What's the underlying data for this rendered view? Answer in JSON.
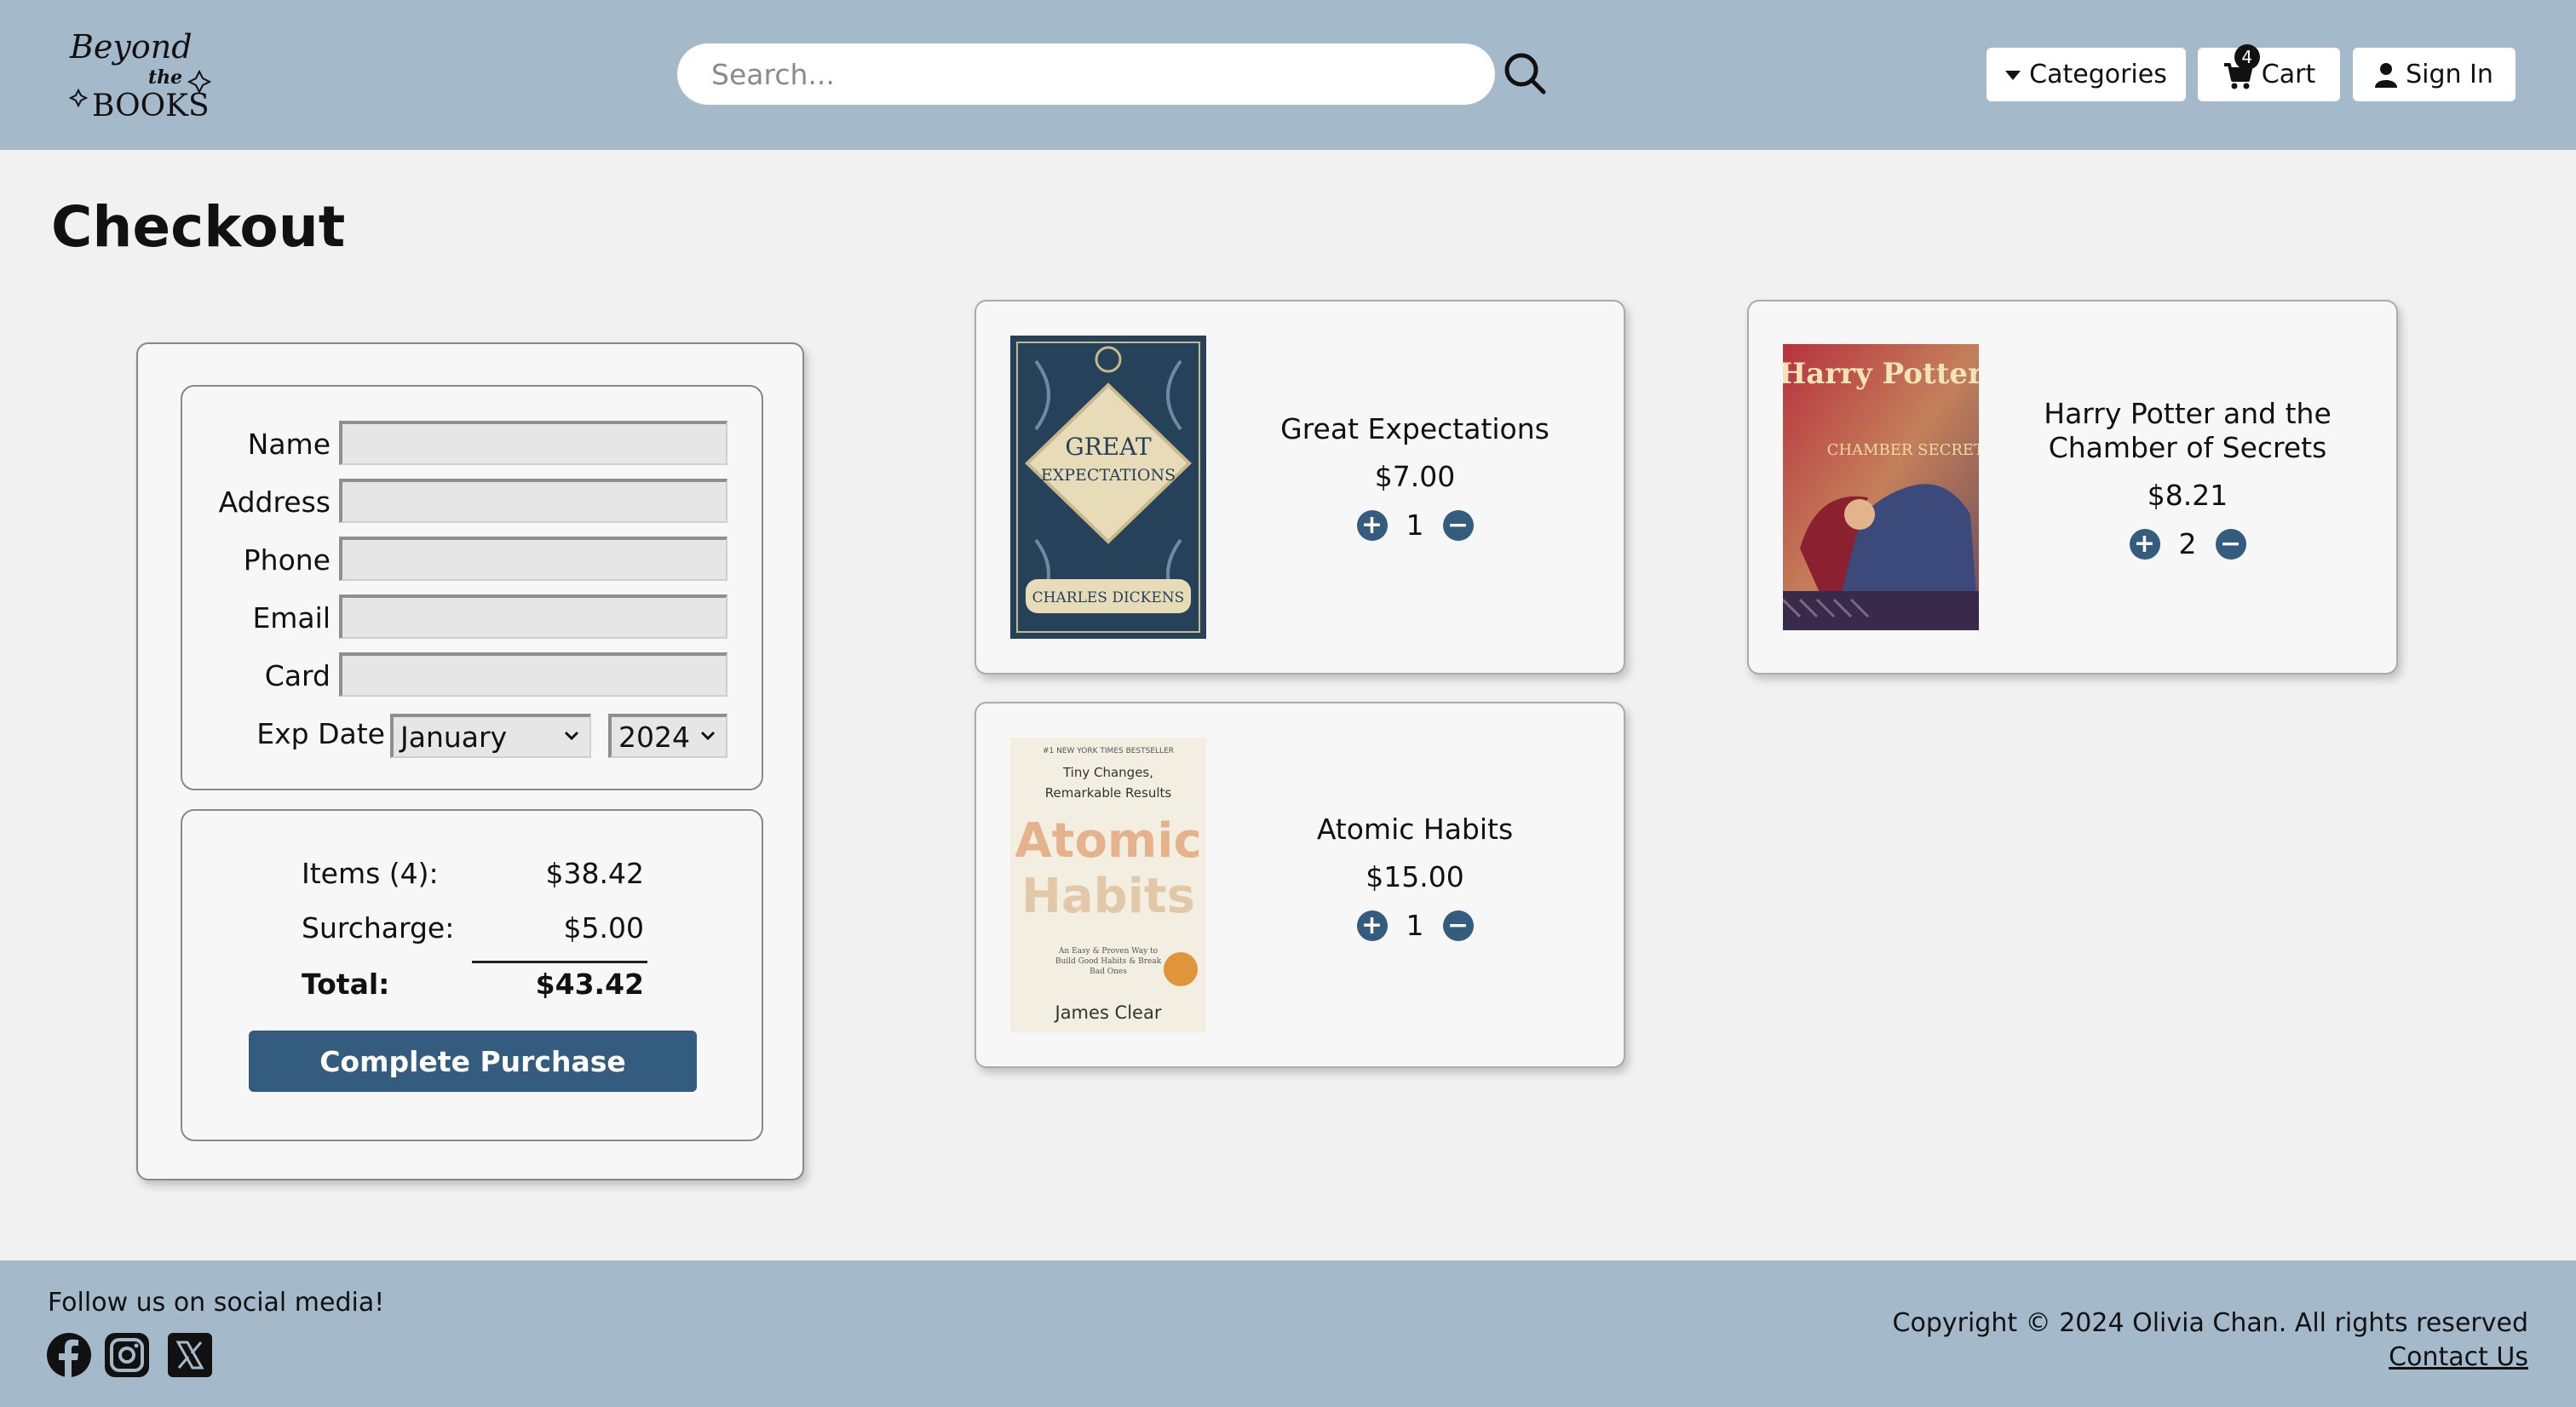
{
  "header": {
    "logo_text": [
      "Beyond",
      "the",
      "BOOKS"
    ],
    "search_placeholder": "Search...",
    "categories_label": "Categories",
    "cart_label": "Cart",
    "cart_count": "4",
    "signin_label": "Sign In"
  },
  "page_title": "Checkout",
  "form": {
    "name_label": "Name",
    "address_label": "Address",
    "phone_label": "Phone",
    "email_label": "Email",
    "card_label": "Card",
    "exp_label": "Exp Date",
    "exp_month": "January",
    "exp_year": "2024"
  },
  "summary": {
    "items_label": "Items (4):",
    "items_value": "$38.42",
    "surcharge_label": "Surcharge:",
    "surcharge_value": "$5.00",
    "total_label": "Total:",
    "total_value": "$43.42",
    "purchase_label": "Complete Purchase"
  },
  "cart_items": [
    {
      "title": "Great Expectations",
      "price": "$7.00",
      "qty": "1",
      "cover": {
        "top": "GREAT",
        "bottom": "EXPECTATIONS",
        "author": "CHARLES DICKENS"
      }
    },
    {
      "title": "Harry Potter and the Chamber of Secrets",
      "price": "$8.21",
      "qty": "2",
      "cover": {
        "top": "Harry Potter",
        "bottom": "CHAMBER SECRETS"
      }
    },
    {
      "title": "Atomic Habits",
      "price": "$15.00",
      "qty": "1",
      "cover": {
        "banner": "#1 NEW YORK TIMES BESTSELLER",
        "tagline1": "Tiny Changes,",
        "tagline2": "Remarkable Results",
        "title1": "Atomic",
        "title2": "Habits",
        "sub": "An Easy & Proven Way to Build Good Habits & Break Bad Ones",
        "author": "James Clear"
      }
    }
  ],
  "footer": {
    "follow_text": "Follow us on social media!",
    "copyright": "Copyright © 2024 Olivia Chan. All rights reserved",
    "contact_label": "Contact Us"
  },
  "colors": {
    "header_bg": "#a4bacb",
    "accent": "#335c7f",
    "page_bg": "#f1f1f1"
  }
}
